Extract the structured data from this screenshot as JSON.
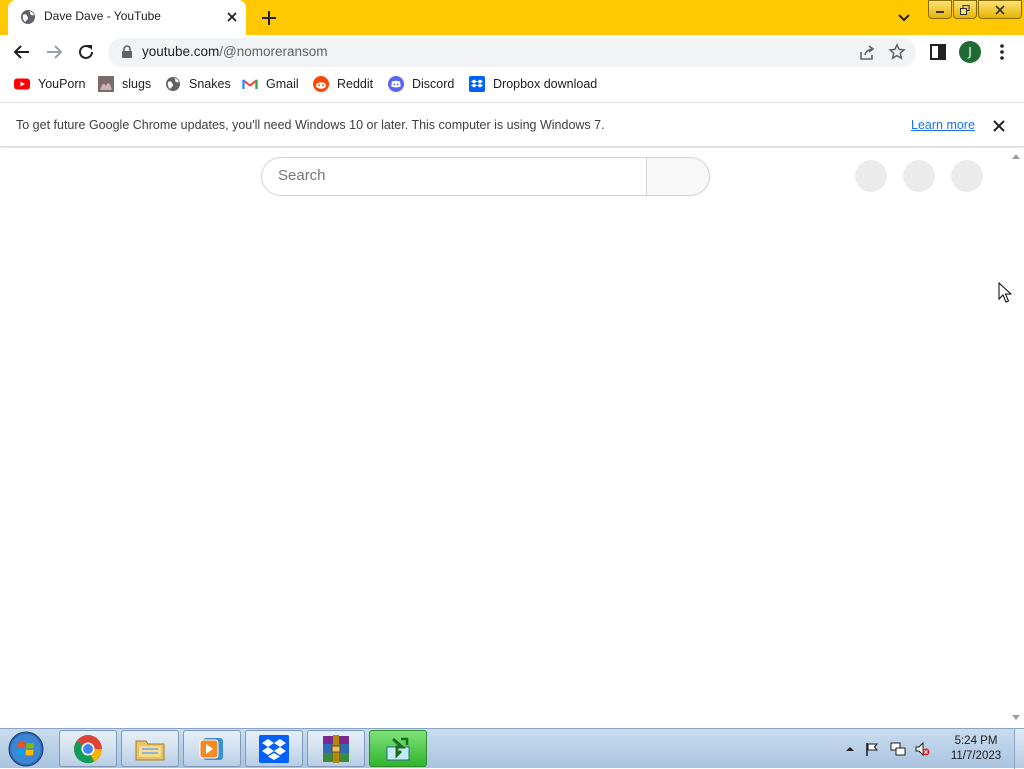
{
  "browser": {
    "tab": {
      "title": "Dave Dave - YouTube",
      "favicon": "globe-icon"
    },
    "address": {
      "host": "youtube.com",
      "path": "/@nomoreransom"
    },
    "profile_initial": "J",
    "colors": {
      "tabstrip": "#ffc800",
      "omnibox": "#f1f3f4",
      "avatar": "#1e6b34",
      "link": "#1a73e8"
    }
  },
  "bookmarks": [
    {
      "label": "YouPorn",
      "icon": "youtube-red-icon"
    },
    {
      "label": "slugs",
      "icon": "image-thumbnail-icon"
    },
    {
      "label": "Snakes",
      "icon": "globe-icon"
    },
    {
      "label": "Gmail",
      "icon": "gmail-icon"
    },
    {
      "label": "Reddit",
      "icon": "reddit-icon"
    },
    {
      "label": "Discord",
      "icon": "discord-icon"
    },
    {
      "label": "Dropbox download",
      "icon": "dropbox-icon"
    }
  ],
  "infobar": {
    "message": "To get future Google Chrome updates, you'll need Windows 10 or later. This computer is using Windows 7.",
    "link": "Learn more"
  },
  "page": {
    "search_placeholder": "Search"
  },
  "taskbar": {
    "apps": [
      "chrome-icon",
      "file-explorer-icon",
      "media-player-icon",
      "dropbox-icon",
      "winrar-icon",
      "download-manager-icon"
    ],
    "clock": {
      "time": "5:24 PM",
      "date": "11/7/2023"
    }
  }
}
